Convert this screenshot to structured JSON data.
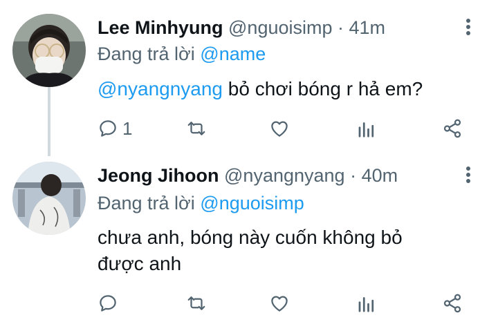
{
  "tweets": [
    {
      "name": "Lee Minhyung",
      "handle": "@nguoisimp",
      "time": "· 41m",
      "reply_prefix": "Đang trả lời",
      "reply_to": "@name",
      "mention": "@nyangnyang",
      "text": " bỏ chơi bóng r hả em?",
      "reply_count": "1",
      "avatar_icon": "person-mask-avatar"
    },
    {
      "name": "Jeong Jihoon",
      "handle": "@nyangnyang",
      "time": "· 40m",
      "reply_prefix": "Đang trả lời",
      "reply_to": "@nguoisimp",
      "text_line1": "chưa anh, bóng này cuốn không bỏ",
      "text_line2": "được anh",
      "avatar_icon": "person-back-avatar"
    }
  ],
  "icons": [
    "reply-icon",
    "retweet-icon",
    "like-icon",
    "analytics-icon",
    "share-icon",
    "more-icon"
  ],
  "colors": {
    "link": "#1d9bf0",
    "muted": "#536471",
    "text": "#0f1419",
    "thread_line": "#cfd9de"
  }
}
